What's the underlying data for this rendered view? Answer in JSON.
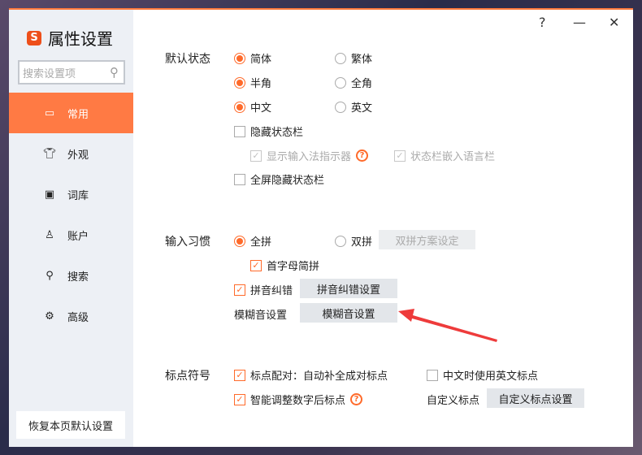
{
  "app": {
    "logo_letter": "S",
    "title": "属性设置",
    "help": "?",
    "minimize": "—",
    "close": "✕"
  },
  "search": {
    "placeholder": "搜索设置项"
  },
  "sidebar": {
    "items": [
      {
        "label": "常用",
        "icon": "monitor-icon"
      },
      {
        "label": "外观",
        "icon": "shirt-icon"
      },
      {
        "label": "词库",
        "icon": "book-icon"
      },
      {
        "label": "账户",
        "icon": "user-icon"
      },
      {
        "label": "搜索",
        "icon": "search-icon"
      },
      {
        "label": "高级",
        "icon": "gear-icon"
      }
    ],
    "reset": "恢复本页默认设置"
  },
  "default_state": {
    "title": "默认状态",
    "simplified": "简体",
    "traditional": "繁体",
    "half": "半角",
    "full": "全角",
    "chinese": "中文",
    "english": "英文",
    "hide_statusbar": "隐藏状态栏",
    "show_indicator": "显示输入法指示器",
    "embed_langbar": "状态栏嵌入语言栏",
    "fullscreen_hide": "全屏隐藏状态栏"
  },
  "input_habit": {
    "title": "输入习惯",
    "quanpin": "全拼",
    "shuangpin": "双拼",
    "shuangpin_btn": "双拼方案设定",
    "initials": "首字母简拼",
    "correction": "拼音纠错",
    "correction_btn": "拼音纠错设置",
    "fuzzy_label": "模糊音设置",
    "fuzzy_btn": "模糊音设置"
  },
  "punct": {
    "title": "标点符号",
    "pairing": "标点配对：自动补全成对标点",
    "cn_use_en": "中文时使用英文标点",
    "smart_number": "智能调整数字后标点",
    "custom_label": "自定义标点",
    "custom_btn": "自定义标点设置"
  },
  "colors": {
    "accent": "#ff7a44",
    "arrow": "#ee3b3b"
  }
}
